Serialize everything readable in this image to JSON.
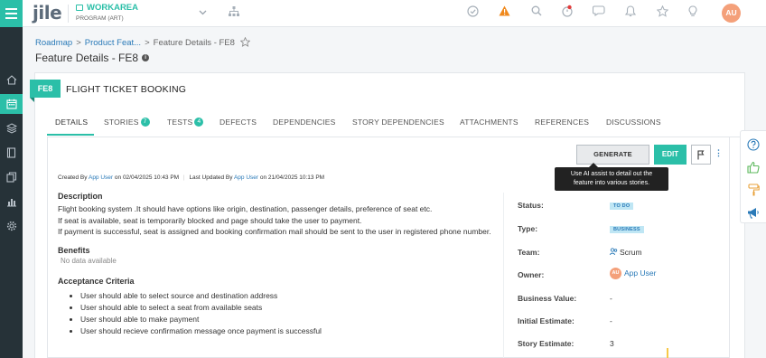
{
  "app": {
    "logo": "jile"
  },
  "workarea": {
    "title": "WORKAREA",
    "subtitle": "PROGRAM (ART)"
  },
  "user": {
    "initials": "AU"
  },
  "breadcrumb": {
    "item1": "Roadmap",
    "item2": "Product Feat...",
    "sep": ">",
    "current": "Feature Details - FE8"
  },
  "page": {
    "title": "Feature Details - FE8",
    "info": "i"
  },
  "feature": {
    "id": "FE8",
    "name": "FLIGHT TICKET BOOKING"
  },
  "tabs": [
    {
      "label": "DETAILS"
    },
    {
      "label": "STORIES",
      "count": "7"
    },
    {
      "label": "TESTS",
      "count": "4"
    },
    {
      "label": "DEFECTS"
    },
    {
      "label": "DEPENDENCIES"
    },
    {
      "label": "STORY DEPENDENCIES"
    },
    {
      "label": "ATTACHMENTS"
    },
    {
      "label": "REFERENCES"
    },
    {
      "label": "DISCUSSIONS"
    }
  ],
  "actions": {
    "generate_stories": "GENERATE STORIES",
    "edit": "EDIT",
    "more": "⋮",
    "tooltip_line1": "Use AI assist to detail out the",
    "tooltip_line2": "feature into various stories."
  },
  "meta": {
    "created_label": "Created By",
    "created_by": "App User",
    "created_on": "on 02/04/2025 10:43 PM",
    "updated_label": "Last Updated By",
    "updated_by": "App User",
    "updated_on": "on 21/04/2025 10:13 PM"
  },
  "description": {
    "heading": "Description",
    "lines": [
      "Flight booking system .It should have options like origin, destination, passenger details, preference of seat etc.",
      "If seat is available, seat is temporarily blocked and page should take the user to payment.",
      "If payment is successful, seat is assigned and booking confirmation mail should be sent to the user in registered phone number."
    ]
  },
  "benefits": {
    "heading": "Benefits",
    "value": "No data available"
  },
  "acceptance": {
    "heading": "Acceptance Criteria",
    "items": [
      "User should able to select source and destination address",
      "User should able to select a seat from available seats",
      "User should able to make payment",
      "User should recieve confirmation message once payment is successful"
    ]
  },
  "fields": {
    "status_label": "Status:",
    "status_value": "TO DO",
    "type_label": "Type:",
    "type_value": "BUSINESS",
    "team_label": "Team:",
    "team_value": "Scrum",
    "owner_label": "Owner:",
    "owner_initials": "AU",
    "owner_value": "App User",
    "business_value_label": "Business Value:",
    "business_value": "-",
    "initial_estimate_label": "Initial Estimate:",
    "initial_estimate": "-",
    "story_estimate_label": "Story Estimate:",
    "story_estimate": "3"
  },
  "colors": {
    "accent": "#2bbfa8",
    "sidebar": "#263238",
    "link": "#2a7ab8",
    "avatar": "#f4a07a",
    "warning": "#f0891c"
  }
}
